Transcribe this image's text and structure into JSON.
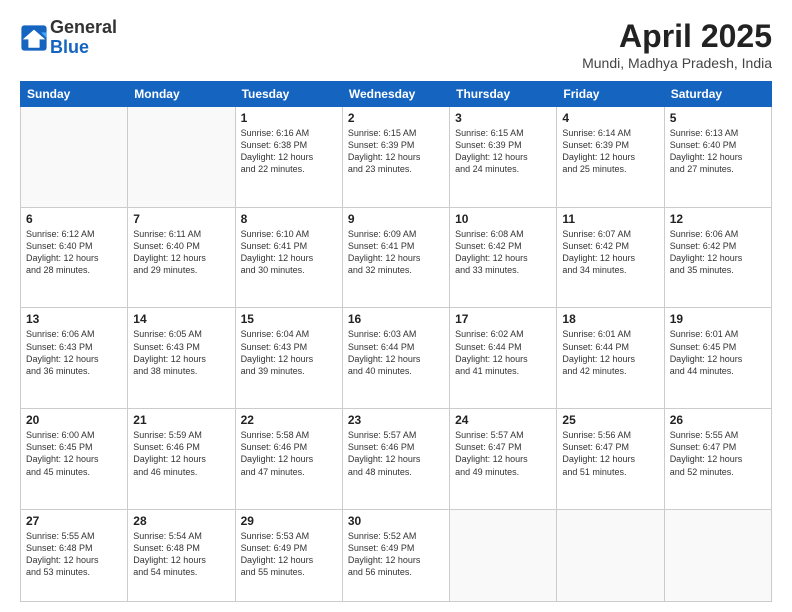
{
  "logo": {
    "general": "General",
    "blue": "Blue"
  },
  "title": {
    "month": "April 2025",
    "location": "Mundi, Madhya Pradesh, India"
  },
  "weekdays": [
    "Sunday",
    "Monday",
    "Tuesday",
    "Wednesday",
    "Thursday",
    "Friday",
    "Saturday"
  ],
  "weeks": [
    [
      {
        "day": "",
        "info": ""
      },
      {
        "day": "",
        "info": ""
      },
      {
        "day": "1",
        "info": "Sunrise: 6:16 AM\nSunset: 6:38 PM\nDaylight: 12 hours\nand 22 minutes."
      },
      {
        "day": "2",
        "info": "Sunrise: 6:15 AM\nSunset: 6:39 PM\nDaylight: 12 hours\nand 23 minutes."
      },
      {
        "day": "3",
        "info": "Sunrise: 6:15 AM\nSunset: 6:39 PM\nDaylight: 12 hours\nand 24 minutes."
      },
      {
        "day": "4",
        "info": "Sunrise: 6:14 AM\nSunset: 6:39 PM\nDaylight: 12 hours\nand 25 minutes."
      },
      {
        "day": "5",
        "info": "Sunrise: 6:13 AM\nSunset: 6:40 PM\nDaylight: 12 hours\nand 27 minutes."
      }
    ],
    [
      {
        "day": "6",
        "info": "Sunrise: 6:12 AM\nSunset: 6:40 PM\nDaylight: 12 hours\nand 28 minutes."
      },
      {
        "day": "7",
        "info": "Sunrise: 6:11 AM\nSunset: 6:40 PM\nDaylight: 12 hours\nand 29 minutes."
      },
      {
        "day": "8",
        "info": "Sunrise: 6:10 AM\nSunset: 6:41 PM\nDaylight: 12 hours\nand 30 minutes."
      },
      {
        "day": "9",
        "info": "Sunrise: 6:09 AM\nSunset: 6:41 PM\nDaylight: 12 hours\nand 32 minutes."
      },
      {
        "day": "10",
        "info": "Sunrise: 6:08 AM\nSunset: 6:42 PM\nDaylight: 12 hours\nand 33 minutes."
      },
      {
        "day": "11",
        "info": "Sunrise: 6:07 AM\nSunset: 6:42 PM\nDaylight: 12 hours\nand 34 minutes."
      },
      {
        "day": "12",
        "info": "Sunrise: 6:06 AM\nSunset: 6:42 PM\nDaylight: 12 hours\nand 35 minutes."
      }
    ],
    [
      {
        "day": "13",
        "info": "Sunrise: 6:06 AM\nSunset: 6:43 PM\nDaylight: 12 hours\nand 36 minutes."
      },
      {
        "day": "14",
        "info": "Sunrise: 6:05 AM\nSunset: 6:43 PM\nDaylight: 12 hours\nand 38 minutes."
      },
      {
        "day": "15",
        "info": "Sunrise: 6:04 AM\nSunset: 6:43 PM\nDaylight: 12 hours\nand 39 minutes."
      },
      {
        "day": "16",
        "info": "Sunrise: 6:03 AM\nSunset: 6:44 PM\nDaylight: 12 hours\nand 40 minutes."
      },
      {
        "day": "17",
        "info": "Sunrise: 6:02 AM\nSunset: 6:44 PM\nDaylight: 12 hours\nand 41 minutes."
      },
      {
        "day": "18",
        "info": "Sunrise: 6:01 AM\nSunset: 6:44 PM\nDaylight: 12 hours\nand 42 minutes."
      },
      {
        "day": "19",
        "info": "Sunrise: 6:01 AM\nSunset: 6:45 PM\nDaylight: 12 hours\nand 44 minutes."
      }
    ],
    [
      {
        "day": "20",
        "info": "Sunrise: 6:00 AM\nSunset: 6:45 PM\nDaylight: 12 hours\nand 45 minutes."
      },
      {
        "day": "21",
        "info": "Sunrise: 5:59 AM\nSunset: 6:46 PM\nDaylight: 12 hours\nand 46 minutes."
      },
      {
        "day": "22",
        "info": "Sunrise: 5:58 AM\nSunset: 6:46 PM\nDaylight: 12 hours\nand 47 minutes."
      },
      {
        "day": "23",
        "info": "Sunrise: 5:57 AM\nSunset: 6:46 PM\nDaylight: 12 hours\nand 48 minutes."
      },
      {
        "day": "24",
        "info": "Sunrise: 5:57 AM\nSunset: 6:47 PM\nDaylight: 12 hours\nand 49 minutes."
      },
      {
        "day": "25",
        "info": "Sunrise: 5:56 AM\nSunset: 6:47 PM\nDaylight: 12 hours\nand 51 minutes."
      },
      {
        "day": "26",
        "info": "Sunrise: 5:55 AM\nSunset: 6:47 PM\nDaylight: 12 hours\nand 52 minutes."
      }
    ],
    [
      {
        "day": "27",
        "info": "Sunrise: 5:55 AM\nSunset: 6:48 PM\nDaylight: 12 hours\nand 53 minutes."
      },
      {
        "day": "28",
        "info": "Sunrise: 5:54 AM\nSunset: 6:48 PM\nDaylight: 12 hours\nand 54 minutes."
      },
      {
        "day": "29",
        "info": "Sunrise: 5:53 AM\nSunset: 6:49 PM\nDaylight: 12 hours\nand 55 minutes."
      },
      {
        "day": "30",
        "info": "Sunrise: 5:52 AM\nSunset: 6:49 PM\nDaylight: 12 hours\nand 56 minutes."
      },
      {
        "day": "",
        "info": ""
      },
      {
        "day": "",
        "info": ""
      },
      {
        "day": "",
        "info": ""
      }
    ]
  ]
}
